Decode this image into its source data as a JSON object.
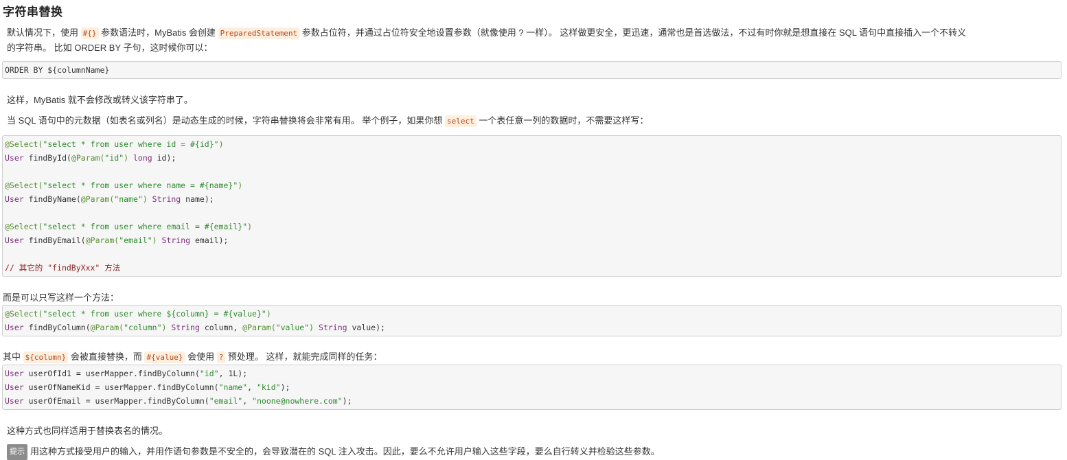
{
  "title": "字符串替换",
  "intro": {
    "t1": "默认情况下，使用 ",
    "c1": "#{}",
    "t2": " 参数语法时，MyBatis 会创建 ",
    "c2": "PreparedStatement",
    "t3": " 参数占位符，并通过占位符安全地设置参数（就像使用 ? 一样）。 这样做更安全，更迅速，通常也是首选做法，不过有时你就是想直接在 SQL 语句中直接插入一个不转义",
    "t4": "的字符串。 比如 ORDER BY 子句，这时候你可以："
  },
  "block1": {
    "lines": [
      "ORDER BY ${columnName}"
    ]
  },
  "para2": "这样，MyBatis 就不会修改或转义该字符串了。",
  "para3": {
    "t1": "当 SQL 语句中的元数据（如表名或列名）是动态生成的时候，字符串替换将会非常有用。 举个例子，如果你想 ",
    "c1": "select",
    "t2": " 一个表任意一列的数据时，不需要这样写："
  },
  "block2": {
    "l1a": "@Select(",
    "l1b": "\"select * from user where id = #{id}\"",
    "l1c": ")",
    "l2a": "User",
    "l2b": " findById(",
    "l2c": "@Param(",
    "l2d": "\"id\"",
    "l2e": ")",
    "l2f": " long",
    "l2g": " id);",
    "l3a": "@Select(",
    "l3b": "\"select * from user where name = #{name}\"",
    "l3c": ")",
    "l4a": "User",
    "l4b": " findByName(",
    "l4c": "@Param(",
    "l4d": "\"name\"",
    "l4e": ")",
    "l4f": " String",
    "l4g": " name);",
    "l5a": "@Select(",
    "l5b": "\"select * from user where email = #{email}\"",
    "l5c": ")",
    "l6a": "User",
    "l6b": " findByEmail(",
    "l6c": "@Param(",
    "l6d": "\"email\"",
    "l6e": ")",
    "l6f": " String",
    "l6g": " email);",
    "l7": "// 其它的 \"findByXxx\" 方法"
  },
  "para4": "而是可以只写这样一个方法：",
  "block3": {
    "l1a": "@Select(",
    "l1b": "\"select * from user where ${column} = #{value}\"",
    "l1c": ")",
    "l2a": "User",
    "l2b": " findByColumn(",
    "l2c": "@Param(",
    "l2d": "\"column\"",
    "l2e": ")",
    "l2f": " String",
    "l2g": " column, ",
    "l2h": "@Param(",
    "l2i": "\"value\"",
    "l2j": ")",
    "l2k": " String",
    "l2l": " value);"
  },
  "para5": {
    "t1": "其中 ",
    "c1": "${column}",
    "t2": " 会被直接替换，而 ",
    "c2": "#{value}",
    "t3": " 会使用 ",
    "c3": "?",
    "t4": " 预处理。 这样，就能完成同样的任务："
  },
  "block4": {
    "l1a": "User",
    "l1b": " userOfId1 = userMapper.findByColumn(",
    "l1c": "\"id\"",
    "l1d": ", 1L);",
    "l2a": "User",
    "l2b": " userOfNameKid = userMapper.findByColumn(",
    "l2c": "\"name\"",
    "l2d": ", ",
    "l2e": "\"kid\"",
    "l2f": ");",
    "l3a": "User",
    "l3b": " userOfEmail = userMapper.findByColumn(",
    "l3c": "\"email\"",
    "l3d": ", ",
    "l3e": "\"noone@nowhere.com\"",
    "l3f": ");"
  },
  "para6": "这种方式也同样适用于替换表名的情况。",
  "tip": {
    "label": "提示",
    "text": "用这种方式接受用户的输入，并用作语句参数是不安全的，会导致潜在的 SQL 注入攻击。因此，要么不允许用户输入这些字段，要么自行转义并检验这些参数。"
  }
}
